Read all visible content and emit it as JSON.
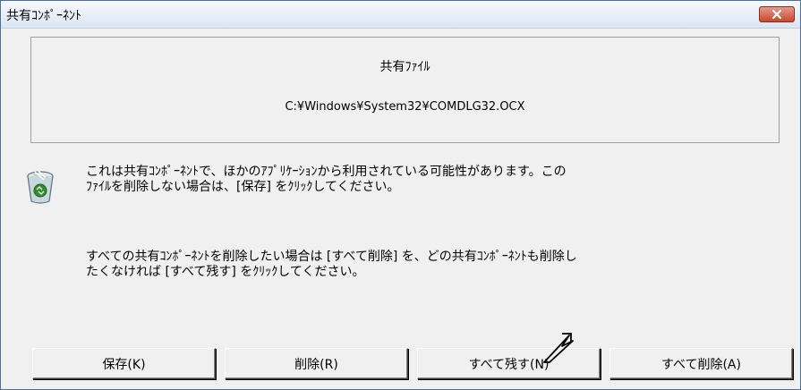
{
  "window": {
    "title": "共有ｺﾝﾎﾟｰﾈﾝﾄ",
    "close_label": "×"
  },
  "panel": {
    "heading": "共有ﾌｧｲﾙ",
    "file_path": "C:¥Windows¥System32¥COMDLG32.OCX"
  },
  "messages": {
    "line1": "これは共有ｺﾝﾎﾟｰﾈﾝﾄで、ほかのｱﾌﾟﾘｹｰｼｮﾝから利用されている可能性があります。この",
    "line2": "ﾌｧｲﾙを削除しない場合は、[保存] をｸﾘｯｸしてください。",
    "line3": "すべての共有ｺﾝﾎﾟｰﾈﾝﾄを削除したい場合は [すべて削除] を、どの共有ｺﾝﾎﾟｰﾈﾝﾄも削除し",
    "line4": "たくなければ [すべて残す] をｸﾘｯｸしてください。"
  },
  "buttons": {
    "keep": "保存(K)",
    "delete": "削除(R)",
    "keep_all": "すべて残す(N)",
    "delete_all": "すべて削除(A)"
  },
  "icons": {
    "recycle_bin": "recycle-bin-icon",
    "close": "close-icon",
    "cursor": "mouse-pointer-icon"
  },
  "colors": {
    "close_button": "#c7482f",
    "window_bg": "#f0f0f0"
  }
}
